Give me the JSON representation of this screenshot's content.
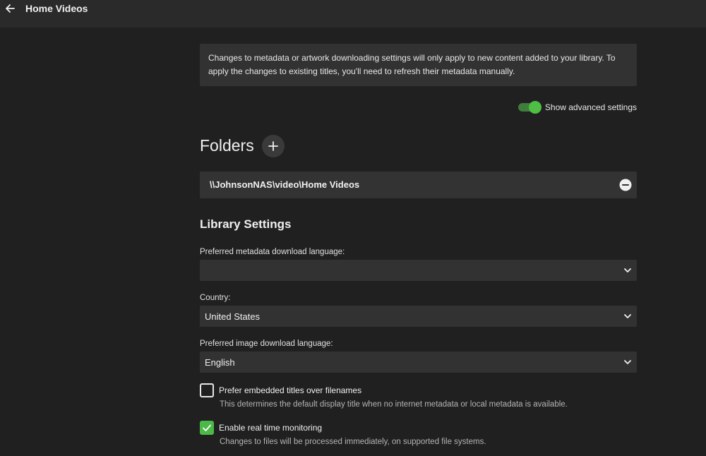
{
  "header": {
    "title": "Home Videos"
  },
  "notice": {
    "text": "Changes to metadata or artwork downloading settings will only apply to new content added to your library. To apply the changes to existing titles, you'll need to refresh their metadata manually."
  },
  "advanced": {
    "label": "Show advanced settings",
    "enabled": true
  },
  "folders": {
    "heading": "Folders",
    "items": [
      {
        "path": "\\\\JohnsonNAS\\video\\Home Videos"
      }
    ]
  },
  "library_settings": {
    "heading": "Library Settings",
    "metadata_language": {
      "label": "Preferred metadata download language:",
      "value": ""
    },
    "country": {
      "label": "Country:",
      "value": "United States"
    },
    "image_language": {
      "label": "Preferred image download language:",
      "value": "English"
    },
    "embedded_titles": {
      "label": "Prefer embedded titles over filenames",
      "description": "This determines the default display title when no internet metadata or local metadata is available.",
      "checked": false
    },
    "realtime_monitoring": {
      "label": "Enable real time monitoring",
      "description": "Changes to files will be processed immediately, on supported file systems.",
      "checked": true
    }
  },
  "colors": {
    "background": "#202020",
    "topbar": "#2a2a2a",
    "panel": "#323232",
    "accent_green": "#4cb848"
  },
  "icons": {
    "back": "arrow-left-icon",
    "add": "plus-icon",
    "remove": "minus-circle-icon",
    "dropdown": "chevron-down-icon",
    "check": "checkmark-icon"
  }
}
